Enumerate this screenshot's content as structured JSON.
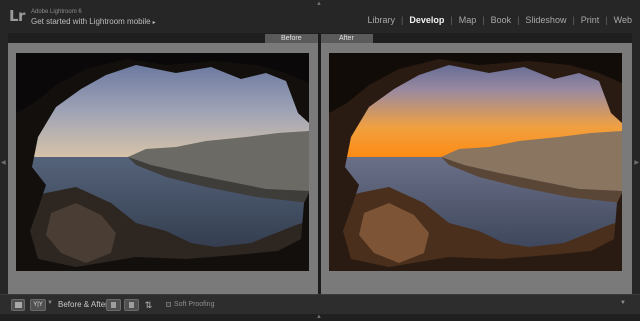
{
  "identity_plate": {
    "logo": "Lr",
    "product": "Adobe Lightroom 6",
    "tagline": "Get started with Lightroom mobile",
    "caret": "▸"
  },
  "modules": [
    "Library",
    "Develop",
    "Map",
    "Book",
    "Slideshow",
    "Print",
    "Web"
  ],
  "active_module": "Develop",
  "before_label": "Before",
  "after_label": "After",
  "toolbar": {
    "view_toggle": "Y|Y",
    "before_after_label": "Before & After :",
    "soft_proofing_label": "Soft Proofing",
    "soft_proofing_checked": false
  },
  "icons": {
    "top_panel_toggle": "triangle-up-icon",
    "bottom_panel_toggle": "triangle-up-icon",
    "left_panel_toggle": "triangle-left-icon",
    "right_panel_toggle": "triangle-right-icon",
    "loupe_view": "loupe-view-icon",
    "copy_settings": "copy-settings-icon",
    "swap": "swap-icon",
    "toolbar_menu": "chevron-down-icon"
  },
  "colors": {
    "active_module": "#f2f2f2",
    "inactive_module": "#a9a9a9",
    "work_area": "#7a7a7a",
    "panel": "#262626"
  }
}
